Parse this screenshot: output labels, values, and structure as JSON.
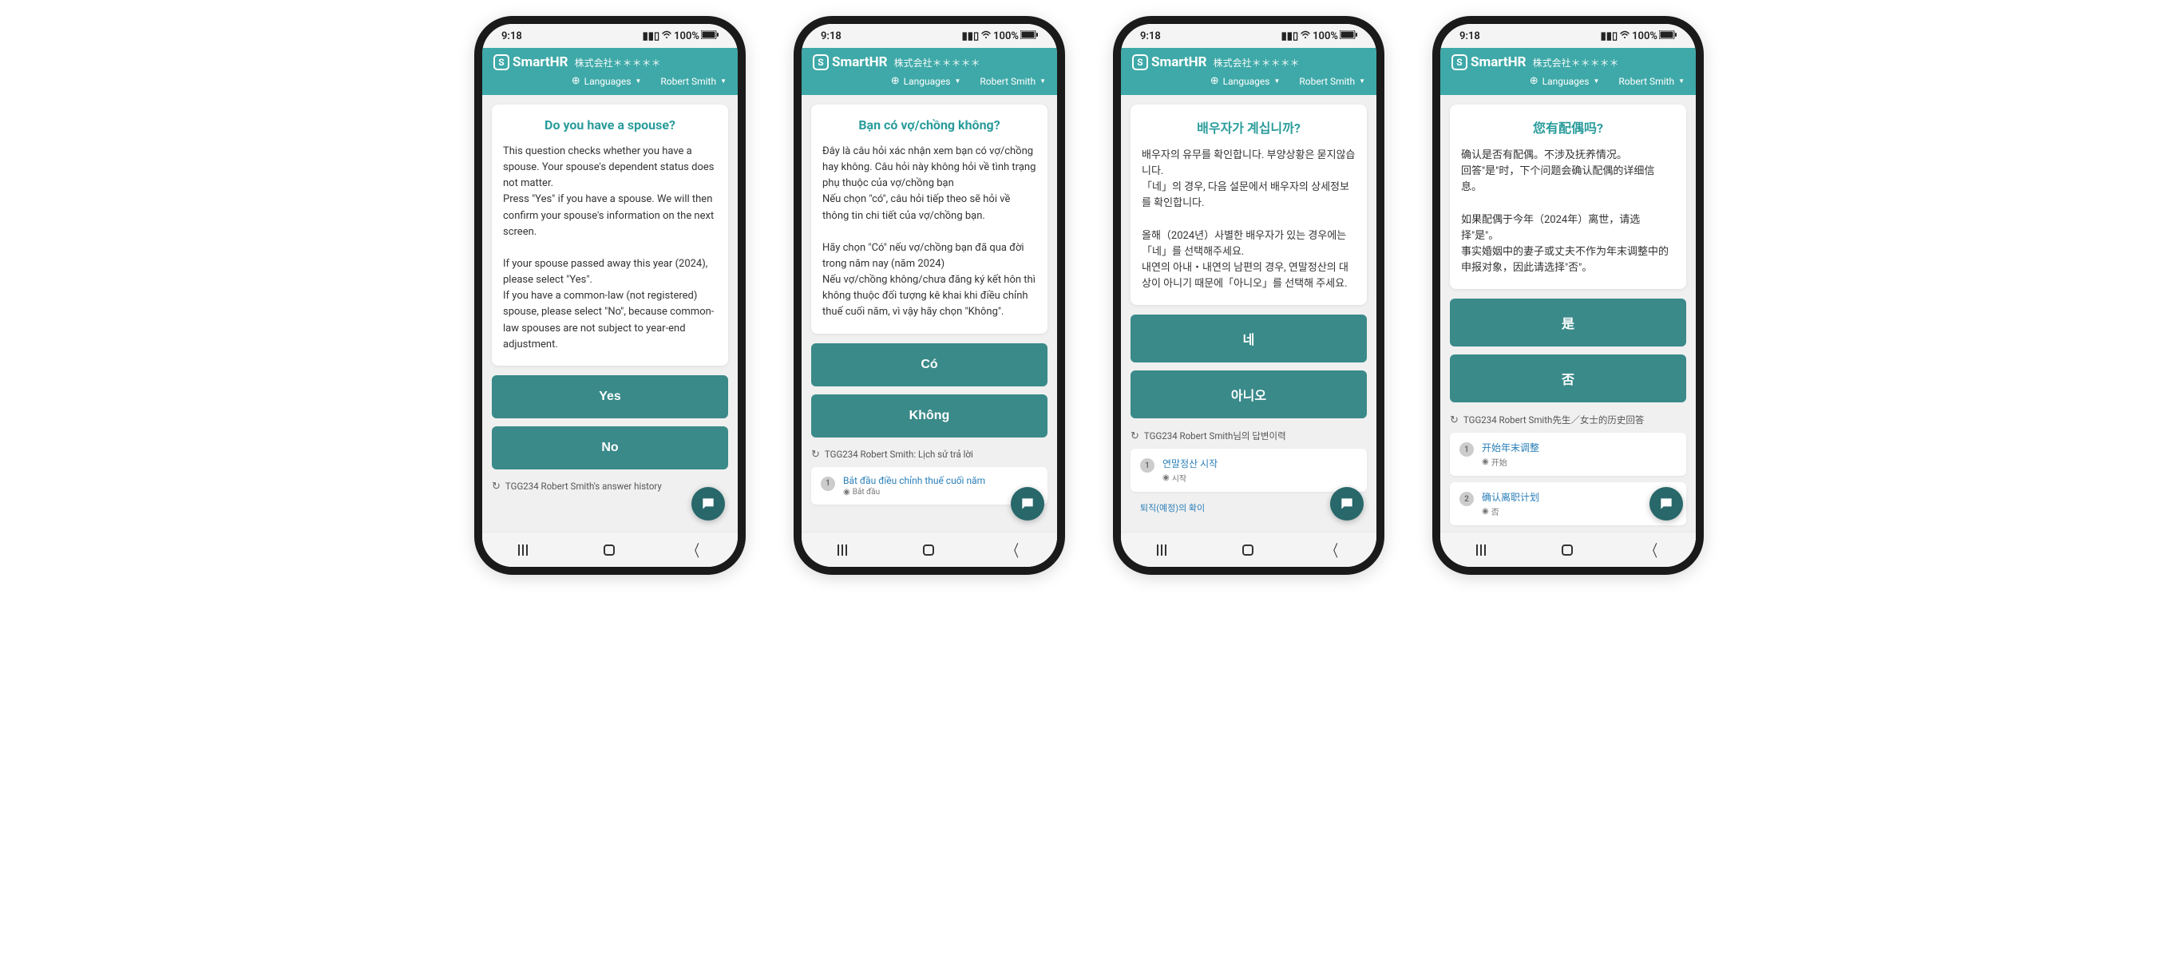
{
  "status": {
    "time": "9:18",
    "battery": "100%"
  },
  "header": {
    "brand": "SmartHR",
    "company": "株式会社＊＊＊＊＊",
    "languages_label": "Languages",
    "user_name": "Robert Smith"
  },
  "phones": [
    {
      "title": "Do you have a spouse?",
      "body": "This question checks whether you have a spouse. Your spouse's dependent status does not matter.\nPress \"Yes\" if you have a spouse. We will then confirm your spouse's information on the next screen.\n\nIf your spouse passed away this year (2024), please select \"Yes\".\nIf you have a common-law (not registered) spouse, please select \"No\", because common-law spouses are not subject to year-end adjustment.",
      "yes": "Yes",
      "no": "No",
      "history_header": "TGG234 Robert Smith's answer history",
      "history": []
    },
    {
      "title": "Bạn có vợ/chồng không?",
      "body": "Đây là câu hỏi xác nhận xem bạn có vợ/chồng hay không. Câu hỏi này không hỏi về tình trạng phụ thuộc của vợ/chồng bạn\nNếu chọn \"có\", câu hỏi tiếp theo sẽ hỏi về thông tin chi tiết của vợ/chồng bạn.\n\nHãy chọn \"Có\" nếu vợ/chồng bạn đã qua đời trong năm nay (năm 2024)\nNếu vợ/chồng không/chưa đăng ký kết hôn thì không thuộc đối tượng kê khai khi điều chỉnh thuế cuối năm, vì vậy hãy chọn \"Không\".",
      "yes": "Có",
      "no": "Không",
      "history_header": "TGG234 Robert Smith: Lịch sử trả lời",
      "history": [
        {
          "num": "1",
          "title": "Bắt đầu điều chỉnh thuế cuối năm",
          "status": "Bắt đầu"
        }
      ]
    },
    {
      "title": "배우자가 계십니까?",
      "body": "배우자의 유무를 확인합니다. 부양상황은 묻지않습니다.\n「네」의 경우, 다음 설문에서 배우자의 상세정보를 확인합니다.\n\n올해（2024년）사별한 배우자가 있는 경우에는 「네」를 선택해주세요.\n내연의 아내・내연의 남편의 경우, 연말정산의 대상이 아니기 때문에「아니오」를 선택해 주세요.",
      "yes": "네",
      "no": "아니오",
      "history_header": "TGG234 Robert Smith님의 답변이력",
      "history": [
        {
          "num": "1",
          "title": "연말정산 시작",
          "status": "시작"
        }
      ],
      "extra_link": "퇴직(예정)의 확이"
    },
    {
      "title": "您有配偶吗?",
      "body": "确认是否有配偶。不涉及抚养情况。\n回答\"是\"时，下个问题会确认配偶的详细信息。\n\n如果配偶于今年（2024年）离世，请选择\"是\"。\n事实婚姻中的妻子或丈夫不作为年末调整中的申报对象，因此请选择\"否\"。",
      "yes": "是",
      "no": "否",
      "history_header": "TGG234 Robert Smith先生／女士的历史回答",
      "history": [
        {
          "num": "1",
          "title": "开始年末调整",
          "status": "开始"
        },
        {
          "num": "2",
          "title": "确认离职计划",
          "status": "否"
        }
      ]
    }
  ]
}
